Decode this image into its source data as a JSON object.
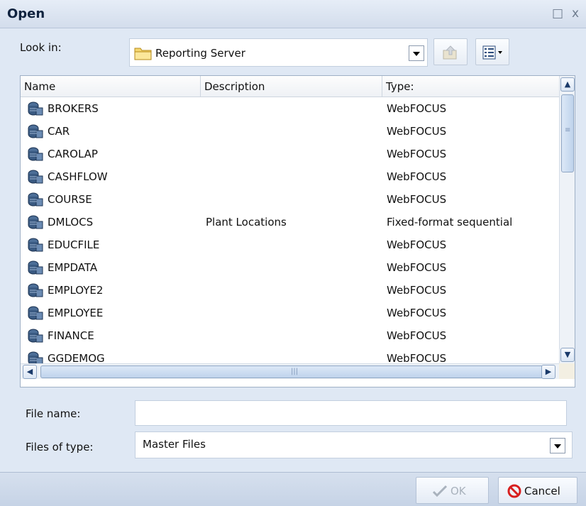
{
  "window": {
    "title": "Open",
    "maximize_glyph": "□",
    "close_glyph": "x"
  },
  "look_in": {
    "label": "Look in:",
    "value": "Reporting Server",
    "icon": "folder-icon"
  },
  "toolbar": {
    "up_icon": "up-folder-icon",
    "view_icon": "view-menu-icon"
  },
  "list": {
    "columns": [
      "Name",
      "Description",
      "Type:"
    ],
    "rows": [
      {
        "name": "BROKERS",
        "description": "",
        "type": "WebFOCUS"
      },
      {
        "name": "CAR",
        "description": "",
        "type": "WebFOCUS"
      },
      {
        "name": "CAROLAP",
        "description": "",
        "type": "WebFOCUS"
      },
      {
        "name": "CASHFLOW",
        "description": "",
        "type": "WebFOCUS"
      },
      {
        "name": "COURSE",
        "description": "",
        "type": "WebFOCUS"
      },
      {
        "name": "DMLOCS",
        "description": "Plant Locations",
        "type": "Fixed-format sequential"
      },
      {
        "name": "EDUCFILE",
        "description": "",
        "type": "WebFOCUS"
      },
      {
        "name": "EMPDATA",
        "description": "",
        "type": "WebFOCUS"
      },
      {
        "name": "EMPLOYE2",
        "description": "",
        "type": "WebFOCUS"
      },
      {
        "name": "EMPLOYEE",
        "description": "",
        "type": "WebFOCUS"
      },
      {
        "name": "FINANCE",
        "description": "",
        "type": "WebFOCUS"
      },
      {
        "name": "GGDEMOG",
        "description": "",
        "type": "WebFOCUS"
      }
    ]
  },
  "file_name": {
    "label": "File name:",
    "value": "",
    "placeholder": ""
  },
  "files_of_type": {
    "label": "Files of type:",
    "value": "Master Files"
  },
  "buttons": {
    "ok": "OK",
    "cancel": "Cancel"
  },
  "colors": {
    "accent": "#1f3f73",
    "cancel_red": "#d81f1f",
    "ok_disabled": "#a9b2bd"
  }
}
